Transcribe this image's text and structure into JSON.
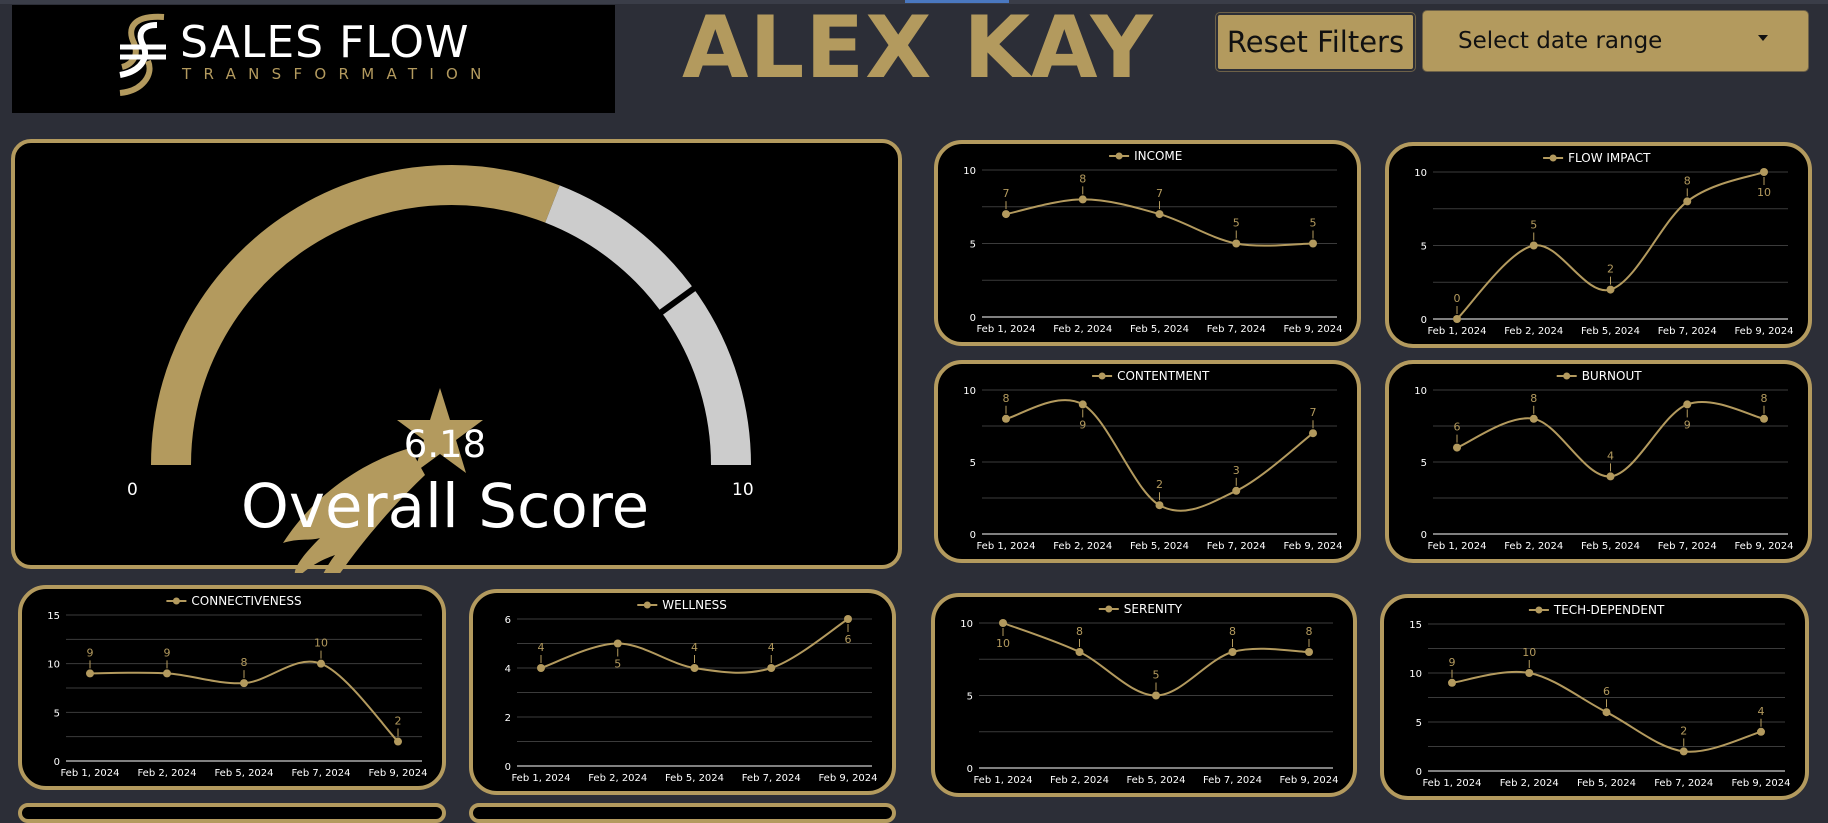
{
  "header": {
    "logo_title": "SALES FLOW",
    "logo_subtitle": "TRANSFORMATION",
    "person_name": "ALEX KAY",
    "reset_label": "Reset Filters",
    "date_placeholder": "Select date range"
  },
  "colors": {
    "accent": "#b39a5e",
    "background": "#2c2e37",
    "panel": "#000000",
    "gauge_track": "#cccccc",
    "text": "#ffffff"
  },
  "icons": {
    "dropdown": "caret-down-icon",
    "gauge": "shooting-star-icon"
  },
  "gauge": {
    "value": "6.18",
    "label": "Overall Score",
    "min": "0",
    "max": "10",
    "value_num": 6.18,
    "min_num": 0,
    "max_num": 10,
    "target_num": 8
  },
  "chart_data": [
    {
      "type": "line",
      "title": "INCOME",
      "categories": [
        "Feb 1, 2024",
        "Feb 2, 2024",
        "Feb 5, 2024",
        "Feb 7, 2024",
        "Feb 9, 2024"
      ],
      "values": [
        7,
        8,
        7,
        5,
        5
      ],
      "ylim": [
        0,
        10
      ],
      "yticks": [
        0,
        5,
        10
      ],
      "grid": true,
      "legend": "top-center"
    },
    {
      "type": "line",
      "title": "FLOW IMPACT",
      "categories": [
        "Feb 1, 2024",
        "Feb 2, 2024",
        "Feb 5, 2024",
        "Feb 7, 2024",
        "Feb 9, 2024"
      ],
      "values": [
        0,
        5,
        2,
        8,
        10
      ],
      "ylim": [
        0,
        10
      ],
      "yticks": [
        0,
        5,
        10
      ],
      "grid": true,
      "legend": "top-center"
    },
    {
      "type": "line",
      "title": "CONTENTMENT",
      "categories": [
        "Feb 1, 2024",
        "Feb 2, 2024",
        "Feb 5, 2024",
        "Feb 7, 2024",
        "Feb 9, 2024"
      ],
      "values": [
        8,
        9,
        2,
        3,
        7
      ],
      "ylim": [
        0,
        10
      ],
      "yticks": [
        0,
        5,
        10
      ],
      "grid": true,
      "legend": "top-center"
    },
    {
      "type": "line",
      "title": "BURNOUT",
      "categories": [
        "Feb 1, 2024",
        "Feb 2, 2024",
        "Feb 5, 2024",
        "Feb 7, 2024",
        "Feb 9, 2024"
      ],
      "values": [
        6,
        8,
        4,
        9,
        8
      ],
      "ylim": [
        0,
        10
      ],
      "yticks": [
        0,
        5,
        10
      ],
      "grid": true,
      "legend": "top-center"
    },
    {
      "type": "line",
      "title": "CONNECTIVENESS",
      "categories": [
        "Feb 1, 2024",
        "Feb 2, 2024",
        "Feb 5, 2024",
        "Feb 7, 2024",
        "Feb 9, 2024"
      ],
      "values": [
        9,
        9,
        8,
        10,
        2
      ],
      "ylim": [
        0,
        15
      ],
      "yticks": [
        0,
        5,
        10,
        15
      ],
      "grid": true,
      "legend": "top-center"
    },
    {
      "type": "line",
      "title": "WELLNESS",
      "categories": [
        "Feb 1, 2024",
        "Feb 2, 2024",
        "Feb 5, 2024",
        "Feb 7, 2024",
        "Feb 9, 2024"
      ],
      "values": [
        4,
        5,
        4,
        4,
        6
      ],
      "ylim": [
        0,
        6
      ],
      "yticks": [
        0,
        2,
        4,
        6
      ],
      "grid": true,
      "legend": "top-center"
    },
    {
      "type": "line",
      "title": "SERENITY",
      "categories": [
        "Feb 1, 2024",
        "Feb 2, 2024",
        "Feb 5, 2024",
        "Feb 7, 2024",
        "Feb 9, 2024"
      ],
      "values": [
        10,
        8,
        5,
        8,
        8
      ],
      "ylim": [
        0,
        10
      ],
      "yticks": [
        0,
        5,
        10
      ],
      "grid": true,
      "legend": "top-center"
    },
    {
      "type": "line",
      "title": "TECH-DEPENDENT",
      "categories": [
        "Feb 1, 2024",
        "Feb 2, 2024",
        "Feb 5, 2024",
        "Feb 7, 2024",
        "Feb 9, 2024"
      ],
      "values": [
        9,
        10,
        6,
        2,
        4
      ],
      "ylim": [
        0,
        15
      ],
      "yticks": [
        0,
        5,
        10,
        15
      ],
      "grid": true,
      "legend": "top-center"
    }
  ]
}
